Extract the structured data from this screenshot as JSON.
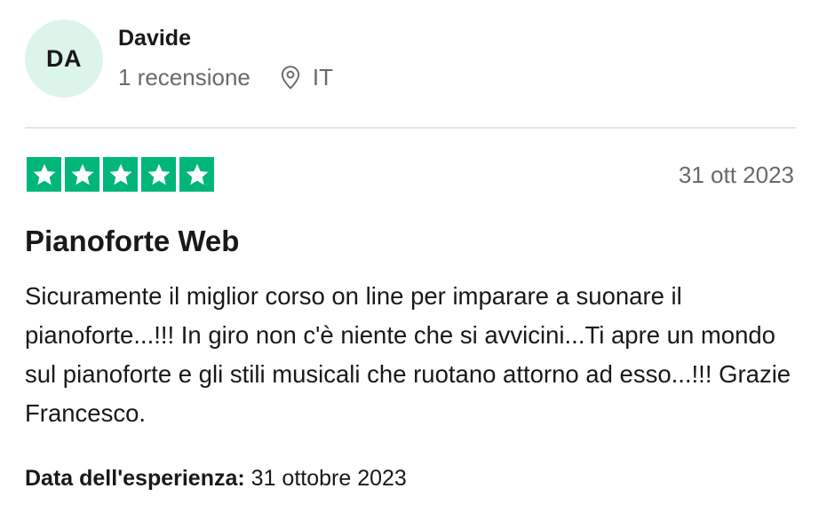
{
  "reviewer": {
    "initials": "DA",
    "name": "Davide",
    "review_count": "1 recensione",
    "country": "IT",
    "avatar_color": "#dcf5ea"
  },
  "review": {
    "rating": 5,
    "rating_max": 5,
    "star_color": "#00b67a",
    "date": "31 ott 2023",
    "title": "Pianoforte Web",
    "body": "Sicuramente il miglior corso on line per imparare a suonare il pianoforte...!!! In giro non c'è niente che si avvicini...Ti apre un mondo sul pianoforte e gli stili musicali che ruotano attorno ad esso...!!! Grazie Francesco.",
    "experience_label": "Data dell'esperienza:",
    "experience_date": "31 ottobre 2023"
  },
  "icons": {
    "location": "location-pin-icon",
    "star": "star-icon"
  }
}
